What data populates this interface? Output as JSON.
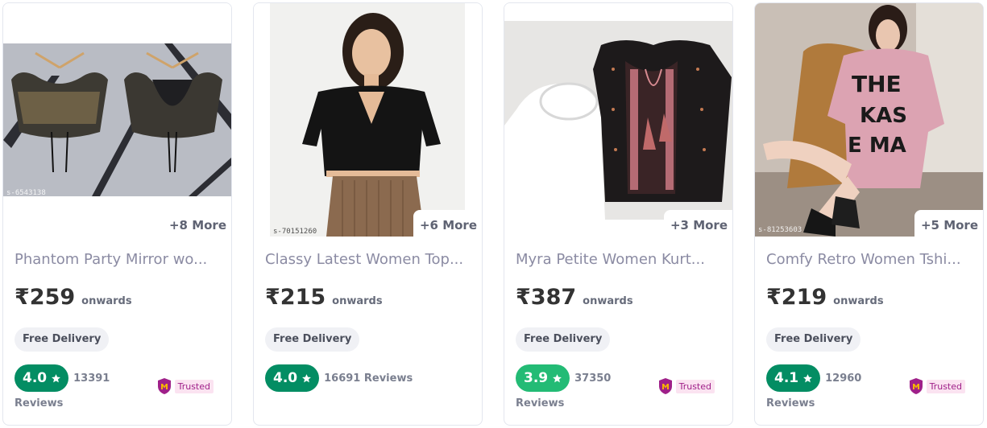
{
  "products": [
    {
      "title": "Phantom Party Mirror wo...",
      "price": "₹259",
      "onwards": "onwards",
      "more": "+8 More",
      "delivery": "Free Delivery",
      "rating": "4.0",
      "reviews_inline": "13391",
      "reviews_below": "Reviews",
      "trusted": "Trusted",
      "rating_color": "#038d63",
      "sku": "s-6543138"
    },
    {
      "title": "Classy Latest Women Top...",
      "price": "₹215",
      "onwards": "onwards",
      "more": "+6 More",
      "delivery": "Free Delivery",
      "rating": "4.0",
      "reviews_inline": "16691 Reviews",
      "reviews_below": "",
      "trusted": "",
      "rating_color": "#038d63",
      "sku": "s-70151260"
    },
    {
      "title": "Myra Petite Women Kurt...",
      "price": "₹387",
      "onwards": "onwards",
      "more": "+3 More",
      "delivery": "Free Delivery",
      "rating": "3.9",
      "reviews_inline": "37350",
      "reviews_below": "Reviews",
      "trusted": "Trusted",
      "rating_color": "#23bb75",
      "sku": "s-49340999"
    },
    {
      "title": "Comfy Retro Women Tshi...",
      "price": "₹219",
      "onwards": "onwards",
      "more": "+5 More",
      "delivery": "Free Delivery",
      "rating": "4.1",
      "reviews_inline": "12960",
      "reviews_below": "Reviews",
      "trusted": "Trusted",
      "rating_color": "#038d63",
      "sku": "s-81253603"
    }
  ]
}
